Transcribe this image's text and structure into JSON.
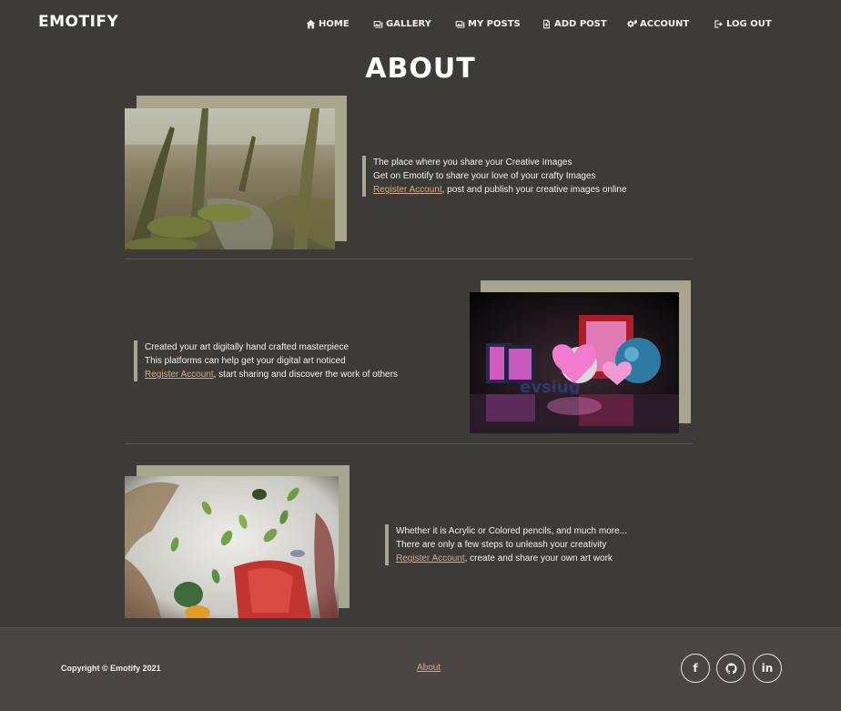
{
  "navbar": {
    "brand": "EMOTIFY",
    "items": [
      {
        "label": "HOME",
        "icon": "home-icon"
      },
      {
        "label": "GALLERY",
        "icon": "gallery-icon"
      },
      {
        "label": "MY POSTS",
        "icon": "my-posts-icon"
      },
      {
        "label": "ADD POST",
        "icon": "add-post-icon"
      },
      {
        "label": "ACCOUNT",
        "icon": "gears-icon"
      },
      {
        "label": "LOG OUT",
        "icon": "logout-icon"
      }
    ]
  },
  "main": {
    "title": "ABOUT",
    "sections": [
      {
        "line1": "The place where you share your Creative Images",
        "line2": "Get on Emotify to share your love of your crafty Images",
        "link": "Register Account",
        "tail": ", post and publish your creative images online",
        "image": "forest-photo"
      },
      {
        "line1": "Created your art digitally hand crafted masterpiece",
        "line2": "This platforms can help get your digital art noticed",
        "link": "Register Account",
        "tail": ", start sharing and discover the work of others",
        "image": "digital-art-render"
      },
      {
        "line1": "Whether it is Acrylic or Colored pencils, and much more...",
        "line2": "There are only a few steps to unleash your creativity",
        "link": "Register Account",
        "tail": ", create and share your own art work",
        "image": "painting-photo"
      }
    ]
  },
  "footer": {
    "copyright": "Copyright © Emotify 2021",
    "about_link": "About",
    "social": [
      {
        "name": "facebook-icon",
        "glyph": "f"
      },
      {
        "name": "github-icon",
        "glyph": ""
      },
      {
        "name": "linkedin-icon",
        "glyph": "in"
      }
    ]
  },
  "colors": {
    "background": "#3d3b37",
    "frame": "#a8a68f",
    "link": "#d9a78a",
    "footer": "#4a4543"
  }
}
